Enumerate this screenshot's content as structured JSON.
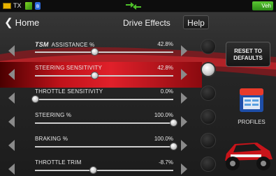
{
  "status_bar": {
    "tx_label": "TX",
    "bluetooth_glyph": "ʙ",
    "vehicle_label": "Veh",
    "icons": [
      "battery-icon",
      "signal-icon",
      "bluetooth-icon",
      "swap-arrows-icon",
      "vehicle-icon"
    ]
  },
  "nav": {
    "back_label": "Home",
    "back_glyph": "❮",
    "title": "Drive Effects",
    "help_label": "Help"
  },
  "rows": [
    {
      "prefix": "TSM",
      "label": "ASSISTANCE %",
      "value": "42.8%",
      "level": 0.428,
      "selected": false
    },
    {
      "prefix": "",
      "label": "STEERING SENSITIVITY",
      "value": "42.8%",
      "level": 0.428,
      "selected": true
    },
    {
      "prefix": "",
      "label": "THROTTLE SENSITIVITY",
      "value": "0.0%",
      "level": 0.0,
      "selected": false
    },
    {
      "prefix": "",
      "label": "STEERING %",
      "value": "100.0%",
      "level": 1.0,
      "selected": false
    },
    {
      "prefix": "",
      "label": "BRAKING %",
      "value": "100.0%",
      "level": 1.0,
      "selected": false
    },
    {
      "prefix": "",
      "label": "THROTTLE TRIM",
      "value": "-8.7%",
      "level": 0.42,
      "selected": false
    }
  ],
  "side": {
    "reset_line1": "RESET TO",
    "reset_line2": "DEFAULTS",
    "profiles_label": "PROFILES",
    "selected_dot_index": 1
  },
  "colors": {
    "accent_red": "#d01820",
    "status_green": "#5ac832",
    "battery_yellow": "#e8b400"
  }
}
